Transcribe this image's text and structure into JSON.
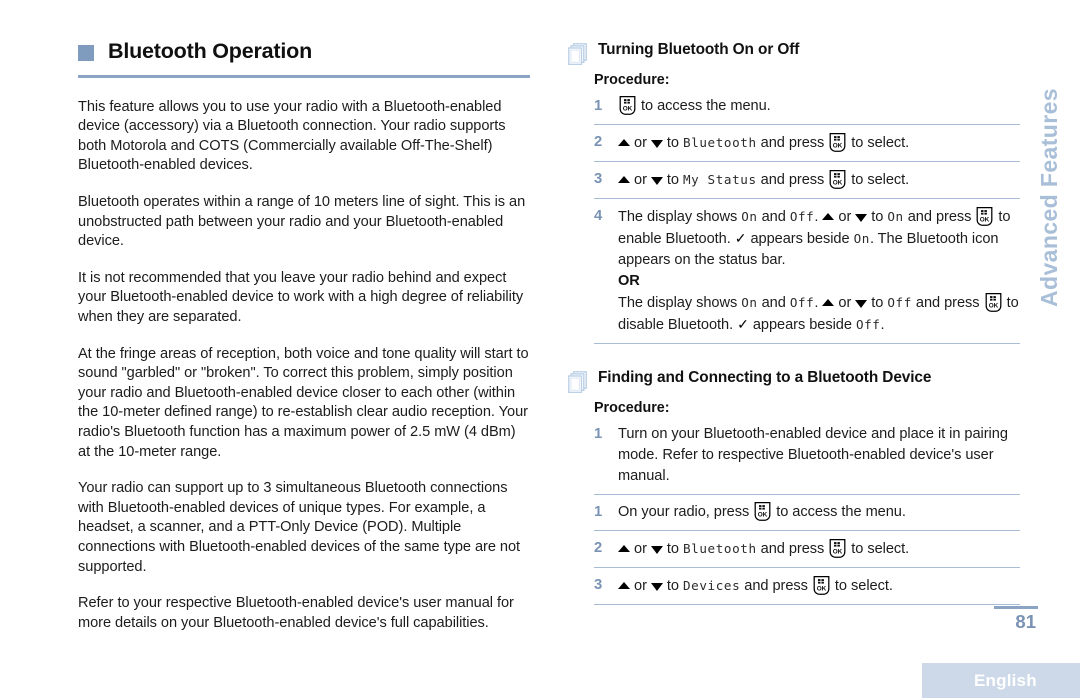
{
  "meta": {
    "page_number": "81",
    "language_footer": "English",
    "side_tab_label": "Advanced Features",
    "accent_blue": "#8ba4c4",
    "step_number_color": "#7a93b4",
    "bullet_color": "#7f9bbd",
    "footer_band_color": "#cdd9e8",
    "side_tab_color": "#a9bfd8"
  },
  "left_column": {
    "chapter_title": "Bluetooth Operation",
    "bullet_icon": "filled-square-bullet",
    "paragraphs": [
      "This feature allows you to use your radio with a Bluetooth-enabled device (accessory) via a Bluetooth connection. Your radio supports both Motorola and COTS (Commercially available Off-The-Shelf) Bluetooth-enabled devices.",
      "Bluetooth operates within a range of 10 meters line of sight. This is an unobstructed path between your radio and your Bluetooth-enabled device.",
      "It is not recommended that you leave your radio behind and expect your Bluetooth-enabled device to work with a high degree of reliability when they are separated.",
      "At the fringe areas of reception, both voice and tone quality will start to sound \"garbled\" or \"broken\". To correct this problem, simply position your radio and Bluetooth-enabled device closer to each other (within the 10-meter defined range) to re-establish clear audio reception. Your radio's Bluetooth function has a maximum power of 2.5 mW (4 dBm) at the 10-meter range.",
      "Your radio can support up to 3 simultaneous Bluetooth connections with Bluetooth-enabled devices of unique types. For example, a headset, a scanner, and a PTT-Only Device (POD). Multiple connections with Bluetooth-enabled devices of the same type are not supported.",
      "Refer to your respective Bluetooth-enabled device's user manual for more details on your Bluetooth-enabled device's full capabilities."
    ]
  },
  "right_column": {
    "sections": [
      {
        "icon": "stacked-pages-icon",
        "title": "Turning Bluetooth On or Off",
        "procedure_label": "Procedure:",
        "steps": [
          {
            "number": "1",
            "parts": [
              {
                "type": "okkey"
              },
              {
                "type": "text",
                "value": " to access the menu."
              }
            ]
          },
          {
            "number": "2",
            "parts": [
              {
                "type": "tri-up"
              },
              {
                "type": "text",
                "value": " or "
              },
              {
                "type": "tri-dn"
              },
              {
                "type": "text",
                "value": " to "
              },
              {
                "type": "lcd",
                "value": "Bluetooth"
              },
              {
                "type": "text",
                "value": " and press "
              },
              {
                "type": "okkey"
              },
              {
                "type": "text",
                "value": " to select."
              }
            ]
          },
          {
            "number": "3",
            "parts": [
              {
                "type": "tri-up"
              },
              {
                "type": "text",
                "value": " or "
              },
              {
                "type": "tri-dn"
              },
              {
                "type": "text",
                "value": " to "
              },
              {
                "type": "lcd",
                "value": "My Status"
              },
              {
                "type": "text",
                "value": " and press "
              },
              {
                "type": "okkey"
              },
              {
                "type": "text",
                "value": " to select."
              }
            ]
          },
          {
            "number": "4",
            "parts": [
              {
                "type": "text",
                "value": "The display shows "
              },
              {
                "type": "lcd",
                "value": "On"
              },
              {
                "type": "text",
                "value": " and "
              },
              {
                "type": "lcd",
                "value": "Off"
              },
              {
                "type": "text",
                "value": ". "
              },
              {
                "type": "tri-up"
              },
              {
                "type": "text",
                "value": " or "
              },
              {
                "type": "tri-dn"
              },
              {
                "type": "text",
                "value": " to "
              },
              {
                "type": "lcd",
                "value": "On"
              },
              {
                "type": "text",
                "value": " and press "
              },
              {
                "type": "okkey"
              },
              {
                "type": "text",
                "value": " to enable Bluetooth. "
              },
              {
                "type": "check"
              },
              {
                "type": "text",
                "value": " appears beside "
              },
              {
                "type": "lcd",
                "value": "On"
              },
              {
                "type": "text",
                "value": ". The Bluetooth icon appears on the status bar."
              },
              {
                "type": "br"
              },
              {
                "type": "or",
                "value": "OR"
              },
              {
                "type": "br"
              },
              {
                "type": "text",
                "value": "The display shows "
              },
              {
                "type": "lcd",
                "value": "On"
              },
              {
                "type": "text",
                "value": " and "
              },
              {
                "type": "lcd",
                "value": "Off"
              },
              {
                "type": "text",
                "value": ". "
              },
              {
                "type": "tri-up"
              },
              {
                "type": "text",
                "value": " or "
              },
              {
                "type": "tri-dn"
              },
              {
                "type": "text",
                "value": " to "
              },
              {
                "type": "lcd",
                "value": "Off"
              },
              {
                "type": "text",
                "value": " and press "
              },
              {
                "type": "okkey"
              },
              {
                "type": "text",
                "value": " to disable Bluetooth. "
              },
              {
                "type": "check"
              },
              {
                "type": "text",
                "value": " appears beside "
              },
              {
                "type": "lcd",
                "value": "Off"
              },
              {
                "type": "text",
                "value": "."
              }
            ]
          }
        ]
      },
      {
        "icon": "stacked-pages-icon",
        "title": "Finding and Connecting to a Bluetooth Device",
        "procedure_label": "Procedure:",
        "steps": [
          {
            "number": "1",
            "parts": [
              {
                "type": "text",
                "value": "Turn on your Bluetooth-enabled device and place it in pairing mode. Refer to respective Bluetooth-enabled device's user manual."
              }
            ]
          },
          {
            "number": "1",
            "parts": [
              {
                "type": "text",
                "value": "On your radio, press "
              },
              {
                "type": "okkey"
              },
              {
                "type": "text",
                "value": " to access the menu."
              }
            ]
          },
          {
            "number": "2",
            "parts": [
              {
                "type": "tri-up"
              },
              {
                "type": "text",
                "value": " or "
              },
              {
                "type": "tri-dn"
              },
              {
                "type": "text",
                "value": " to "
              },
              {
                "type": "lcd",
                "value": "Bluetooth"
              },
              {
                "type": "text",
                "value": " and press "
              },
              {
                "type": "okkey"
              },
              {
                "type": "text",
                "value": " to select."
              }
            ]
          },
          {
            "number": "3",
            "parts": [
              {
                "type": "tri-up"
              },
              {
                "type": "text",
                "value": " or "
              },
              {
                "type": "tri-dn"
              },
              {
                "type": "text",
                "value": " to "
              },
              {
                "type": "lcd",
                "value": "Devices"
              },
              {
                "type": "text",
                "value": " and press "
              },
              {
                "type": "okkey"
              },
              {
                "type": "text",
                "value": " to select."
              }
            ]
          }
        ]
      }
    ]
  }
}
